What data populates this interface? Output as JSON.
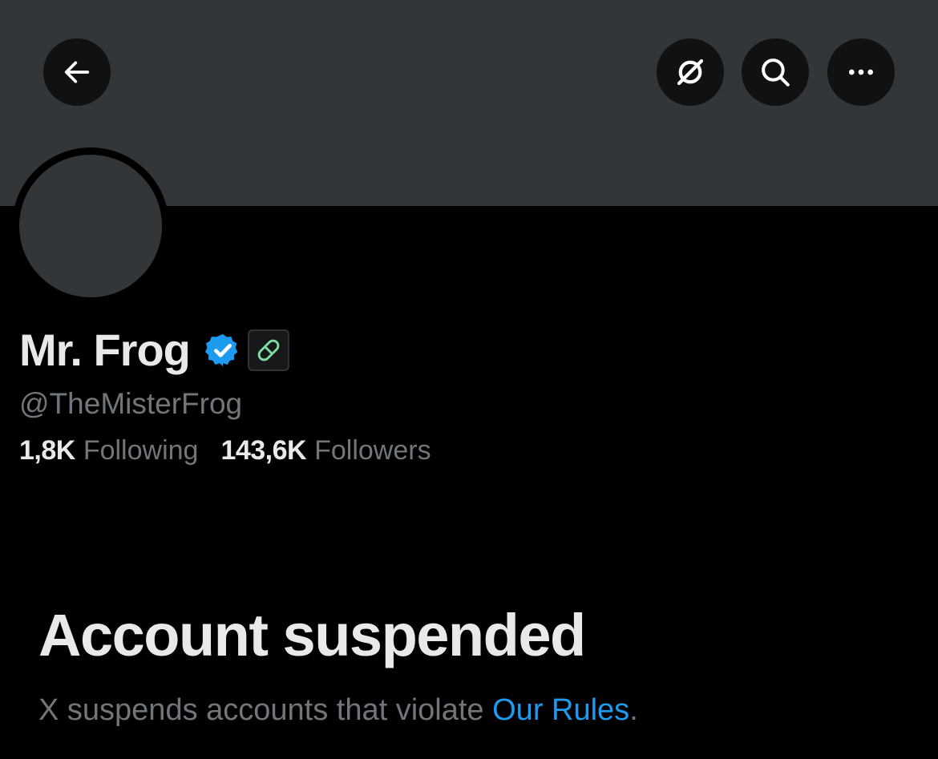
{
  "header": {
    "back_icon": "arrow-left-icon",
    "grok_icon": "grok-icon",
    "search_icon": "search-icon",
    "more_icon": "more-horizontal-icon"
  },
  "profile": {
    "display_name": "Mr. Frog",
    "handle": "@TheMisterFrog",
    "verified_icon": "verified-badge-icon",
    "affiliate_icon": "pill-icon",
    "following_count": "1,8K",
    "following_label": "Following",
    "followers_count": "143,6K",
    "followers_label": "Followers"
  },
  "suspension": {
    "title": "Account suspended",
    "description_prefix": "X suspends accounts that violate ",
    "rules_link": "Our Rules",
    "description_suffix": "."
  },
  "colors": {
    "background": "#000000",
    "banner": "#333639",
    "text_primary": "#e7e9ea",
    "text_secondary": "#71767b",
    "link": "#1d9bf0",
    "verified": "#1d9bf0",
    "pill": "#7ee0a0"
  }
}
